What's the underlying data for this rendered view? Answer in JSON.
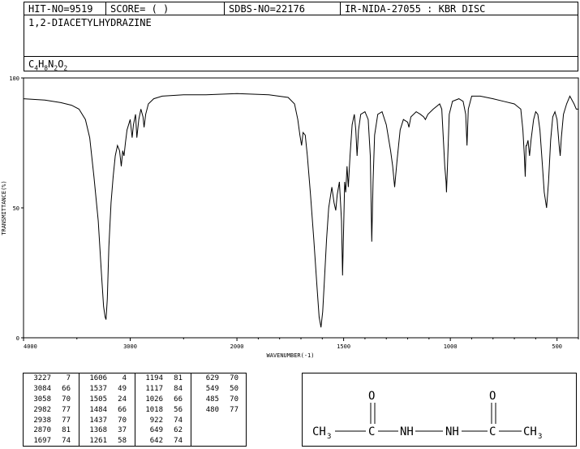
{
  "header": {
    "hit_no": "HIT-NO=9519",
    "score": "SCORE=  (   )",
    "sdbs_no": "SDBS-NO=22176",
    "ir_nida": "IR-NIDA-27055 : KBR DISC"
  },
  "compound_name": "1,2-DIACETYLHYDRAZINE",
  "formula": {
    "parts": [
      "C",
      "4",
      "H",
      "8",
      "N",
      "2",
      "O",
      "2"
    ]
  },
  "chart_data": {
    "type": "line",
    "title": "",
    "xlabel": "WAVENUMBER(-1)",
    "ylabel": "TRANSMITTANCE(%)",
    "xlim": [
      4000,
      400
    ],
    "ylim": [
      0,
      100
    ],
    "x_ticks": [
      "4000",
      "3000",
      "2000",
      "1500",
      "1000",
      "500"
    ],
    "x_tick_values": [
      4000,
      3000,
      2000,
      1500,
      1000,
      500
    ],
    "y_ticks": [
      "100",
      "50",
      "0"
    ],
    "y_tick_values": [
      100,
      50,
      0
    ],
    "series": [
      {
        "values": [
          [
            4000,
            92
          ],
          [
            3800,
            91.5
          ],
          [
            3650,
            90.5
          ],
          [
            3550,
            89.5
          ],
          [
            3480,
            88
          ],
          [
            3420,
            84
          ],
          [
            3380,
            77
          ],
          [
            3340,
            62
          ],
          [
            3300,
            45
          ],
          [
            3270,
            25
          ],
          [
            3250,
            12
          ],
          [
            3235,
            8
          ],
          [
            3227,
            7
          ],
          [
            3215,
            15
          ],
          [
            3200,
            35
          ],
          [
            3180,
            52
          ],
          [
            3160,
            62
          ],
          [
            3140,
            70
          ],
          [
            3120,
            74
          ],
          [
            3100,
            72
          ],
          [
            3084,
            66
          ],
          [
            3070,
            72
          ],
          [
            3058,
            70
          ],
          [
            3045,
            75
          ],
          [
            3030,
            80
          ],
          [
            3000,
            84
          ],
          [
            2982,
            77
          ],
          [
            2970,
            82
          ],
          [
            2950,
            86
          ],
          [
            2938,
            77
          ],
          [
            2920,
            84
          ],
          [
            2900,
            88
          ],
          [
            2880,
            85
          ],
          [
            2870,
            81
          ],
          [
            2855,
            86
          ],
          [
            2830,
            90
          ],
          [
            2780,
            92
          ],
          [
            2700,
            93
          ],
          [
            2500,
            93.5
          ],
          [
            2300,
            93.5
          ],
          [
            2000,
            94
          ],
          [
            1850,
            93.5
          ],
          [
            1760,
            92.5
          ],
          [
            1730,
            90
          ],
          [
            1715,
            84
          ],
          [
            1705,
            78
          ],
          [
            1697,
            74
          ],
          [
            1690,
            79
          ],
          [
            1680,
            78
          ],
          [
            1670,
            70
          ],
          [
            1655,
            55
          ],
          [
            1640,
            38
          ],
          [
            1625,
            20
          ],
          [
            1615,
            8
          ],
          [
            1606,
            4
          ],
          [
            1598,
            10
          ],
          [
            1590,
            22
          ],
          [
            1580,
            38
          ],
          [
            1570,
            50
          ],
          [
            1555,
            58
          ],
          [
            1545,
            52
          ],
          [
            1537,
            49
          ],
          [
            1530,
            55
          ],
          [
            1520,
            60
          ],
          [
            1510,
            45
          ],
          [
            1505,
            24
          ],
          [
            1500,
            42
          ],
          [
            1495,
            60
          ],
          [
            1490,
            56
          ],
          [
            1484,
            66
          ],
          [
            1478,
            58
          ],
          [
            1470,
            70
          ],
          [
            1460,
            82
          ],
          [
            1450,
            86
          ],
          [
            1443,
            80
          ],
          [
            1437,
            70
          ],
          [
            1430,
            80
          ],
          [
            1420,
            86
          ],
          [
            1400,
            87
          ],
          [
            1385,
            84
          ],
          [
            1375,
            70
          ],
          [
            1368,
            37
          ],
          [
            1362,
            60
          ],
          [
            1355,
            78
          ],
          [
            1340,
            86
          ],
          [
            1320,
            87
          ],
          [
            1300,
            82
          ],
          [
            1280,
            72
          ],
          [
            1270,
            66
          ],
          [
            1261,
            58
          ],
          [
            1250,
            68
          ],
          [
            1235,
            80
          ],
          [
            1220,
            84
          ],
          [
            1200,
            83
          ],
          [
            1194,
            81
          ],
          [
            1185,
            85
          ],
          [
            1160,
            87
          ],
          [
            1140,
            86
          ],
          [
            1125,
            85
          ],
          [
            1117,
            84
          ],
          [
            1105,
            86
          ],
          [
            1080,
            88
          ],
          [
            1050,
            90
          ],
          [
            1040,
            88
          ],
          [
            1030,
            72
          ],
          [
            1026,
            66
          ],
          [
            1020,
            60
          ],
          [
            1018,
            56
          ],
          [
            1014,
            65
          ],
          [
            1005,
            86
          ],
          [
            990,
            91
          ],
          [
            960,
            92
          ],
          [
            940,
            91
          ],
          [
            928,
            86
          ],
          [
            922,
            74
          ],
          [
            916,
            88
          ],
          [
            900,
            93
          ],
          [
            860,
            93
          ],
          [
            800,
            92
          ],
          [
            750,
            91
          ],
          [
            700,
            90
          ],
          [
            670,
            88
          ],
          [
            660,
            80
          ],
          [
            653,
            70
          ],
          [
            649,
            62
          ],
          [
            645,
            74
          ],
          [
            642,
            74
          ],
          [
            636,
            76
          ],
          [
            629,
            70
          ],
          [
            622,
            76
          ],
          [
            610,
            84
          ],
          [
            600,
            87
          ],
          [
            590,
            86
          ],
          [
            580,
            80
          ],
          [
            570,
            68
          ],
          [
            560,
            56
          ],
          [
            549,
            50
          ],
          [
            540,
            60
          ],
          [
            530,
            76
          ],
          [
            520,
            85
          ],
          [
            510,
            87
          ],
          [
            500,
            84
          ],
          [
            490,
            74
          ],
          [
            485,
            70
          ],
          [
            480,
            77
          ],
          [
            470,
            86
          ],
          [
            455,
            90
          ],
          [
            440,
            93
          ],
          [
            420,
            90
          ],
          [
            410,
            88
          ],
          [
            400,
            88
          ]
        ]
      }
    ]
  },
  "peaks": [
    [
      "3227",
      "7"
    ],
    [
      "3084",
      "66"
    ],
    [
      "3058",
      "70"
    ],
    [
      "2982",
      "77"
    ],
    [
      "2938",
      "77"
    ],
    [
      "2870",
      "81"
    ],
    [
      "1697",
      "74"
    ],
    [
      "1606",
      "4"
    ],
    [
      "1537",
      "49"
    ],
    [
      "1505",
      "24"
    ],
    [
      "1484",
      "66"
    ],
    [
      "1437",
      "70"
    ],
    [
      "1368",
      "37"
    ],
    [
      "1261",
      "58"
    ],
    [
      "1194",
      "81"
    ],
    [
      "1117",
      "84"
    ],
    [
      "1026",
      "66"
    ],
    [
      "1018",
      "56"
    ],
    [
      "922",
      "74"
    ],
    [
      "649",
      "62"
    ],
    [
      "642",
      "74"
    ],
    [
      "629",
      "70"
    ],
    [
      "549",
      "50"
    ],
    [
      "485",
      "70"
    ],
    [
      "480",
      "77"
    ]
  ],
  "structure": {
    "ch3_left": "CH",
    "ch3_left_sub": "3",
    "c_left": "C",
    "nh_left": "NH",
    "nh_right": "NH",
    "c_right": "C",
    "ch3_right": "CH",
    "ch3_right_sub": "3",
    "o_left": "O",
    "o_right": "O"
  }
}
